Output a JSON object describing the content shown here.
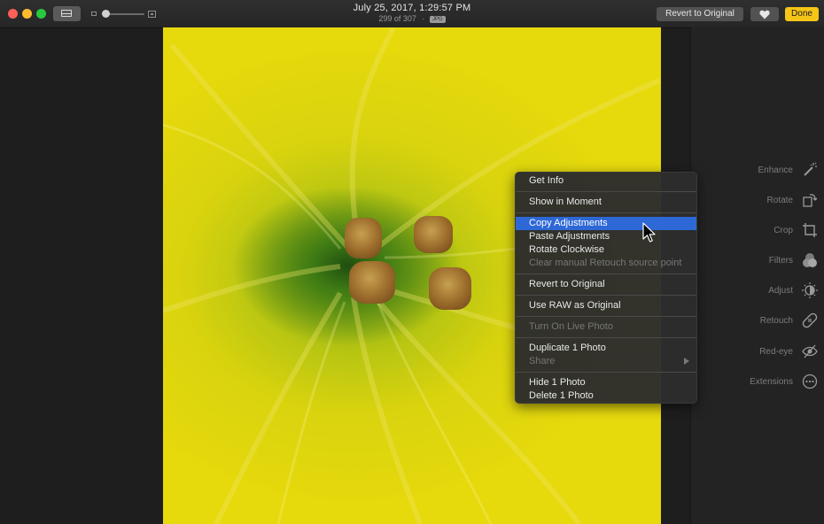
{
  "window": {
    "title": "July 25, 2017, 1:29:57 PM",
    "counter": "299 of 307",
    "separator": "·",
    "format_badge": "JPG"
  },
  "toolbar": {
    "revert_label": "Revert to Original",
    "done_label": "Done",
    "accent_color": "#f5c518"
  },
  "tools": [
    {
      "label": "Enhance",
      "icon": "magic-wand-icon"
    },
    {
      "label": "Rotate",
      "icon": "rotate-icon"
    },
    {
      "label": "Crop",
      "icon": "crop-icon"
    },
    {
      "label": "Filters",
      "icon": "filters-icon"
    },
    {
      "label": "Adjust",
      "icon": "adjust-icon"
    },
    {
      "label": "Retouch",
      "icon": "bandage-icon"
    },
    {
      "label": "Red-eye",
      "icon": "red-eye-icon"
    },
    {
      "label": "Extensions",
      "icon": "more-icon"
    }
  ],
  "menu": {
    "selection_color": "#2d68d6",
    "items": [
      {
        "label": "Get Info",
        "enabled": true
      },
      {
        "label": "Show in Moment",
        "enabled": true
      },
      {
        "label": "Copy Adjustments",
        "enabled": true,
        "selected": true
      },
      {
        "label": "Paste Adjustments",
        "enabled": true
      },
      {
        "label": "Rotate Clockwise",
        "enabled": true
      },
      {
        "label": "Clear manual Retouch source point",
        "enabled": false
      },
      {
        "label": "Revert to Original",
        "enabled": true
      },
      {
        "label": "Use RAW as Original",
        "enabled": true
      },
      {
        "label": "Turn On Live Photo",
        "enabled": false
      },
      {
        "label": "Duplicate 1 Photo",
        "enabled": true
      },
      {
        "label": "Share",
        "enabled": false,
        "has_submenu": true
      },
      {
        "label": "Hide 1 Photo",
        "enabled": true
      },
      {
        "label": "Delete 1 Photo",
        "enabled": true
      }
    ]
  }
}
